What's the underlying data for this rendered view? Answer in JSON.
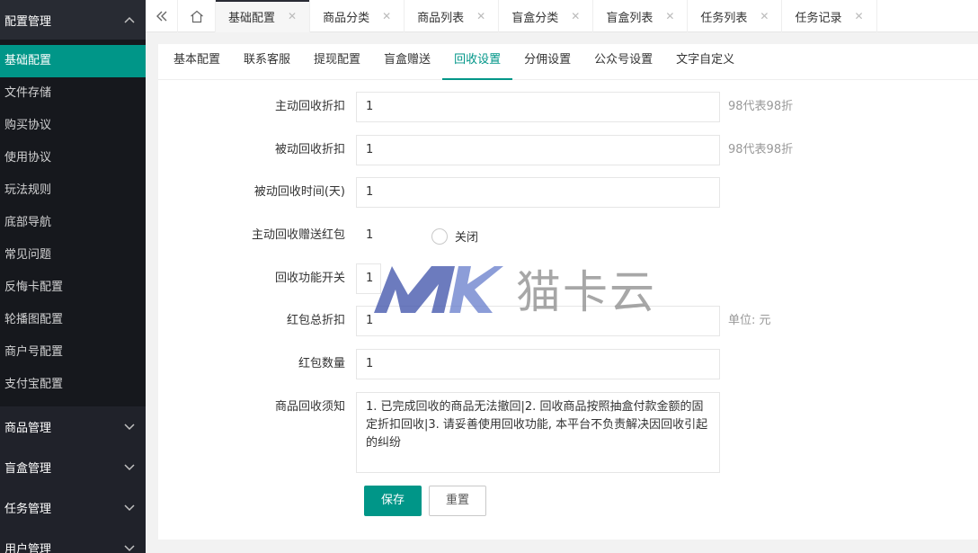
{
  "sidebar": {
    "group_title": "配置管理",
    "items": [
      {
        "label": "基础配置",
        "active": true
      },
      {
        "label": "文件存储"
      },
      {
        "label": "购买协议"
      },
      {
        "label": "使用协议"
      },
      {
        "label": "玩法规则"
      },
      {
        "label": "底部导航"
      },
      {
        "label": "常见问题"
      },
      {
        "label": "反悔卡配置"
      },
      {
        "label": "轮播图配置"
      },
      {
        "label": "商户号配置"
      },
      {
        "label": "支付宝配置"
      }
    ],
    "groups": [
      {
        "label": "商品管理"
      },
      {
        "label": "盲盒管理"
      },
      {
        "label": "任务管理"
      },
      {
        "label": "用户管理"
      }
    ]
  },
  "topbar": {
    "tabs": [
      {
        "label": "基础配置",
        "active": true
      },
      {
        "label": "商品分类"
      },
      {
        "label": "商品列表"
      },
      {
        "label": "盲盒分类"
      },
      {
        "label": "盲盒列表"
      },
      {
        "label": "任务列表"
      },
      {
        "label": "任务记录"
      }
    ]
  },
  "subtabs": [
    {
      "label": "基本配置"
    },
    {
      "label": "联系客服"
    },
    {
      "label": "提现配置"
    },
    {
      "label": "盲盒赠送"
    },
    {
      "label": "回收设置",
      "active": true
    },
    {
      "label": "分佣设置"
    },
    {
      "label": "公众号设置"
    },
    {
      "label": "文字自定义"
    }
  ],
  "form": {
    "active_discount": {
      "label": "主动回收折扣",
      "value": "1",
      "hint": "98代表98折"
    },
    "passive_discount": {
      "label": "被动回收折扣",
      "value": "1",
      "hint": "98代表98折"
    },
    "passive_time": {
      "label": "被动回收时间(天)",
      "value": "1"
    },
    "gift_packet": {
      "label": "主动回收赠送红包",
      "value": "1",
      "radio_label": "关闭"
    },
    "recycle_switch": {
      "label": "回收功能开关",
      "value": "1"
    },
    "packet_total": {
      "label": "红包总折扣",
      "value": "1",
      "hint": "单位: 元"
    },
    "packet_count": {
      "label": "红包数量",
      "value": "1"
    },
    "notice": {
      "label": "商品回收须知",
      "value": "1. 已完成回收的商品无法撤回|2. 回收商品按照抽盒付款金额的固定折扣回收|3. 请妥善使用回收功能, 本平台不负责解决因回收引起的纠纷"
    },
    "save_label": "保存",
    "reset_label": "重置"
  },
  "watermark": {
    "text": "猫卡云",
    "logo": "MK"
  },
  "colors": {
    "accent": "#009688",
    "sidebar_bg": "#20222a"
  }
}
